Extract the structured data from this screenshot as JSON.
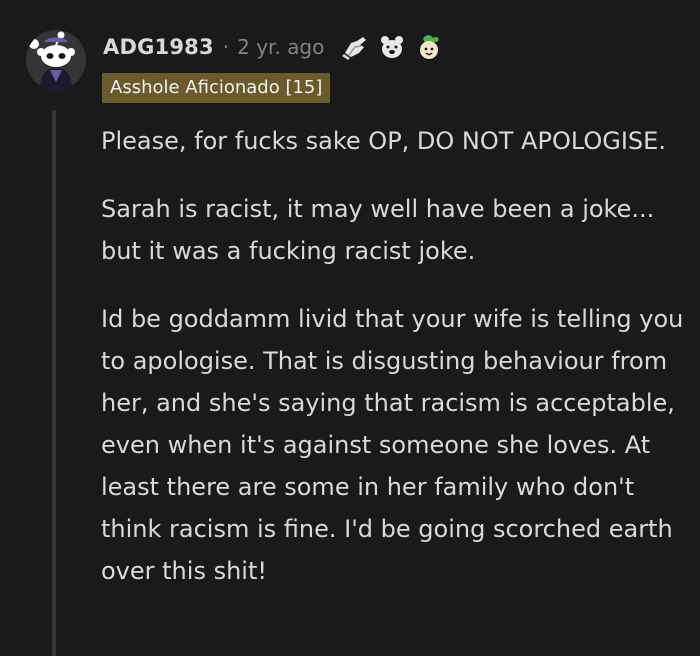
{
  "comment": {
    "username": "ADG1983",
    "separator": "·",
    "timestamp": "2 yr. ago",
    "awards": [
      {
        "icon": "helpful-hand-award-icon"
      },
      {
        "icon": "wholesome-bear-award-icon"
      },
      {
        "icon": "plant-pot-award-icon"
      }
    ],
    "flair": "Asshole Aficionado [15]",
    "flair_color": "#6b5a2b",
    "paragraphs": [
      "Please, for fucks sake OP, DO NOT APOLOGISE.",
      "Sarah is racist, it may well have been a joke... but it was a fucking racist joke.",
      "Id be goddamm livid that your wife is telling you to apologise. That is disgusting behaviour from her, and she's saying that racism is acceptable, even when it's against someone she loves. At least there are some in her family who don't think racism is fine. I'd be going scorched earth over this shit!"
    ]
  },
  "theme": {
    "background": "#1a1a1b",
    "text": "#d7dadc",
    "muted": "#818384"
  }
}
